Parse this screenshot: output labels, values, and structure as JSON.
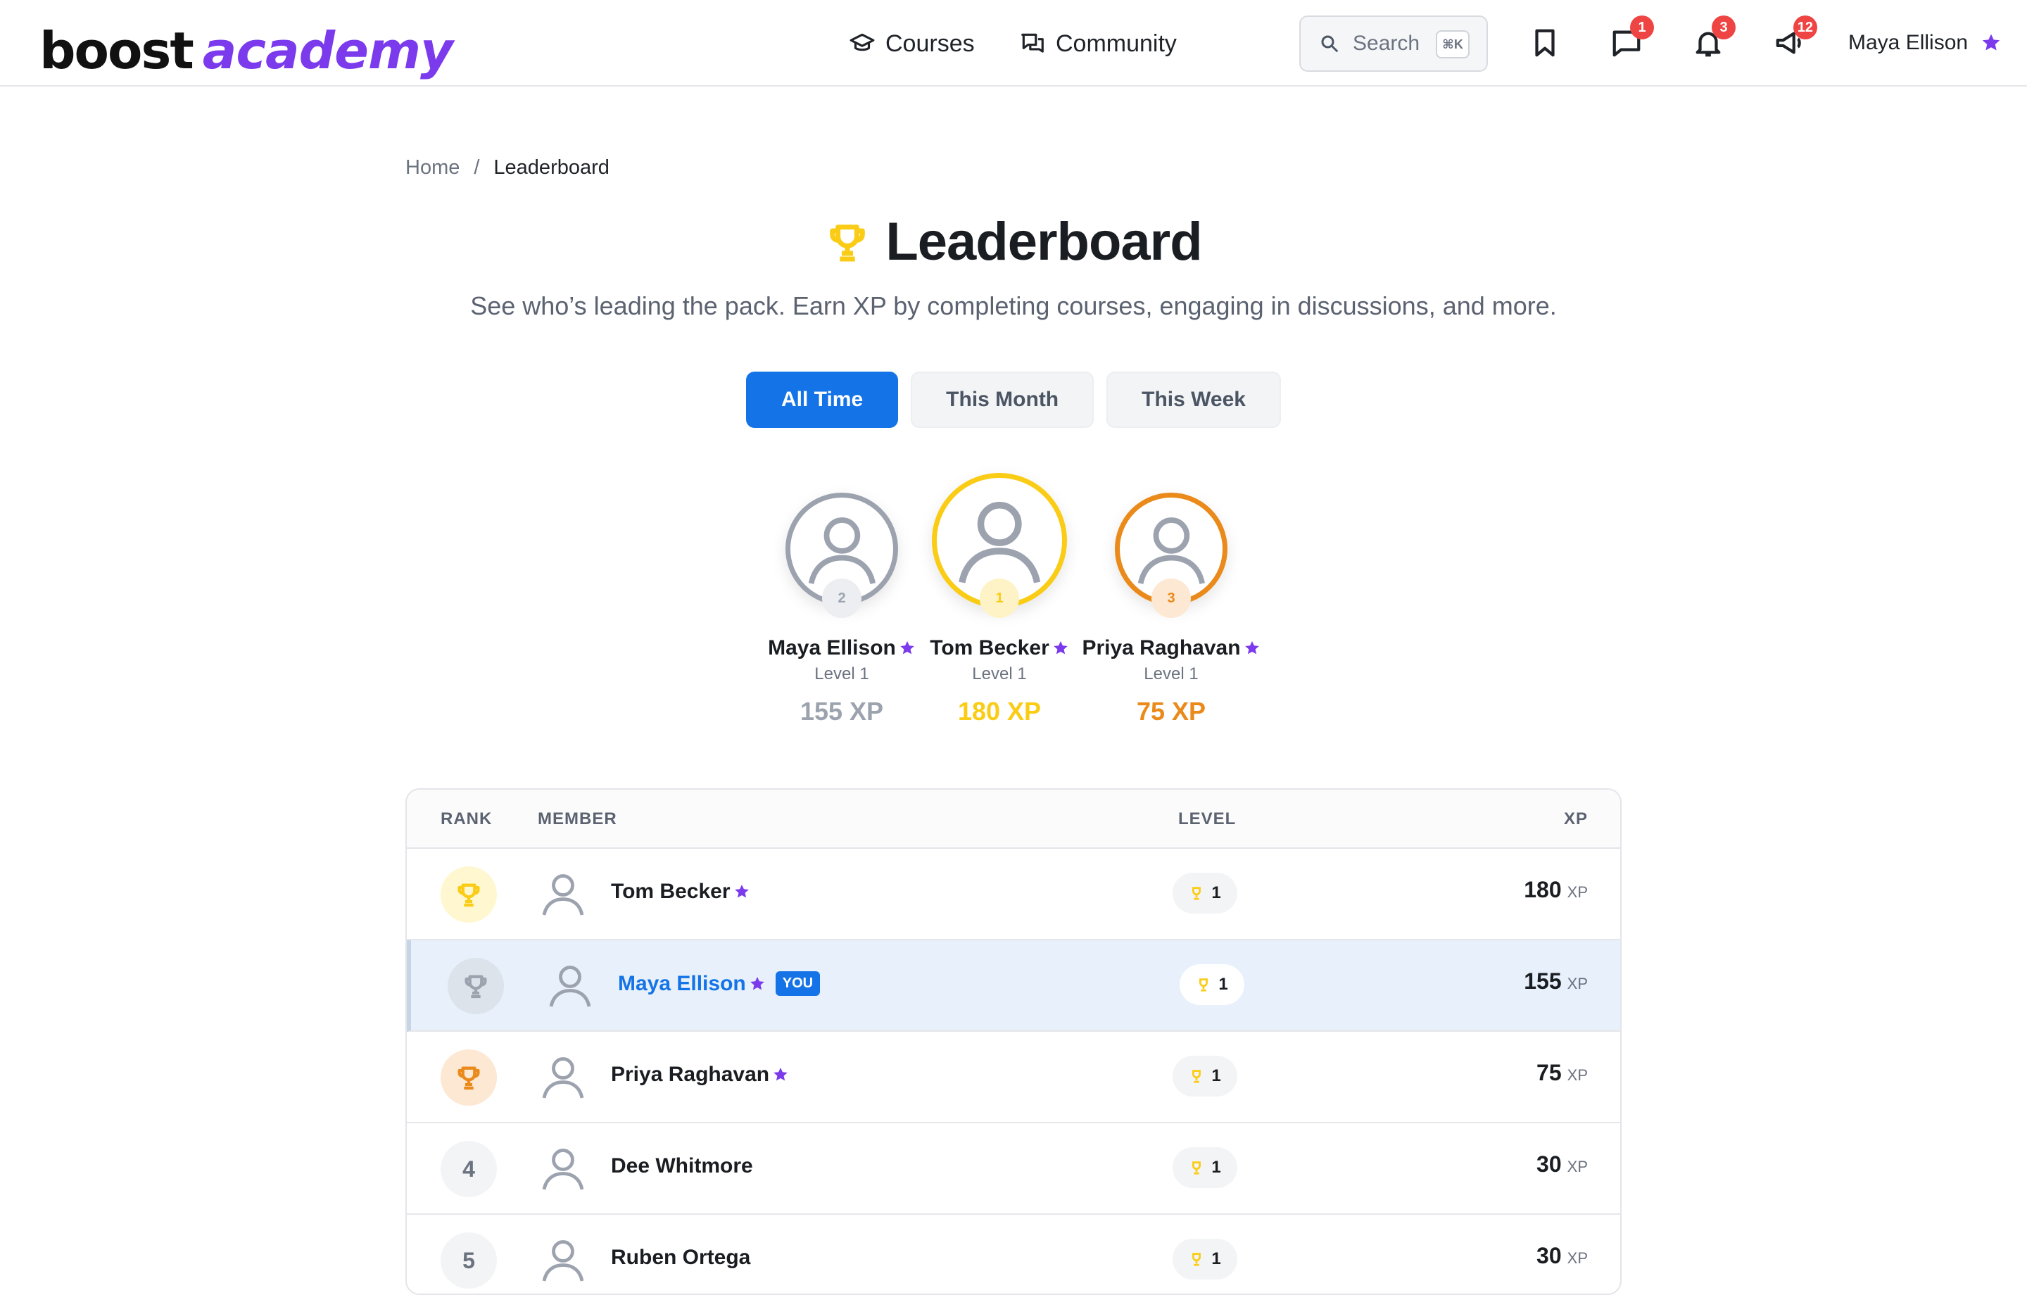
{
  "brand": {
    "part1": "boost",
    "part2": "academy"
  },
  "nav": {
    "courses": "Courses",
    "community": "Community"
  },
  "search": {
    "placeholder": "Search",
    "shortcut": "⌘K"
  },
  "header_icons": {
    "bookmark": {
      "icon": "bookmark-icon"
    },
    "messages": {
      "icon": "chat-icon",
      "badge": "1"
    },
    "notifications": {
      "icon": "bell-icon",
      "badge": "3"
    },
    "announcements": {
      "icon": "megaphone-icon",
      "badge": "12"
    }
  },
  "user": {
    "name": "Maya Ellison"
  },
  "breadcrumb": {
    "home": "Home",
    "separator": "/",
    "current": "Leaderboard"
  },
  "page": {
    "title": "Leaderboard",
    "subtitle": "See who’s leading the pack. Earn XP by completing courses, engaging in discussions, and more."
  },
  "tabs": [
    {
      "label": "All Time",
      "active": true
    },
    {
      "label": "This Month",
      "active": false
    },
    {
      "label": "This Week",
      "active": false
    }
  ],
  "podium": [
    {
      "rank": "2",
      "name": "Maya Ellison",
      "level": "Level 1",
      "xp": "155 XP",
      "color": "#9ca3af"
    },
    {
      "rank": "1",
      "name": "Tom Becker",
      "level": "Level 1",
      "xp": "180 XP",
      "color": "#facc15"
    },
    {
      "rank": "3",
      "name": "Priya Raghavan",
      "level": "Level 1",
      "xp": "75 XP",
      "color": "#ea8a1a"
    }
  ],
  "table": {
    "headers": {
      "rank": "RANK",
      "member": "MEMBER",
      "level": "LEVEL",
      "xp": "XP"
    },
    "xp_unit": "XP",
    "you_label": "YOU",
    "rows": [
      {
        "rank": "1",
        "name": "Tom Becker",
        "starred": true,
        "level": "1",
        "xp": "180",
        "medal": "gold"
      },
      {
        "rank": "2",
        "name": "Maya Ellison",
        "starred": true,
        "level": "1",
        "xp": "155",
        "medal": "silver",
        "is_me": true
      },
      {
        "rank": "3",
        "name": "Priya Raghavan",
        "starred": true,
        "level": "1",
        "xp": "75",
        "medal": "bronze"
      },
      {
        "rank": "4",
        "name": "Dee Whitmore",
        "starred": false,
        "level": "1",
        "xp": "30",
        "medal": "none"
      },
      {
        "rank": "5",
        "name": "Ruben Ortega",
        "starred": false,
        "level": "1",
        "xp": "30",
        "medal": "none"
      }
    ]
  },
  "colors": {
    "accent": "#1473e6",
    "brand_purple": "#7c3aed",
    "gold": "#facc15",
    "silver": "#9ca3af",
    "bronze": "#ea8a1a",
    "badge_red": "#ef4444"
  }
}
